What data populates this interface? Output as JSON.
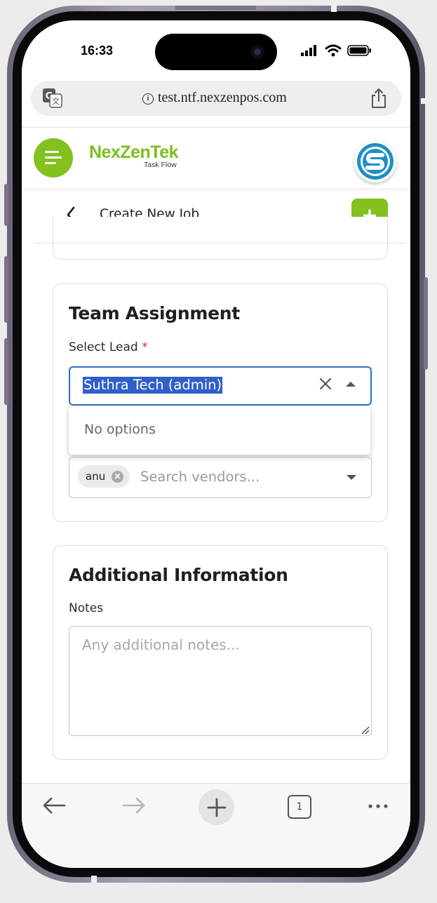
{
  "status_bar": {
    "time": "16:33"
  },
  "browser": {
    "url": "test.ntf.nexzenpos.com",
    "tab_count": "1"
  },
  "app": {
    "brand_name": "NexZenTek",
    "brand_tagline": "Task Flow",
    "page_title": "Create New Job",
    "add_label": "+"
  },
  "team_assignment": {
    "title": "Team Assignment",
    "lead_label": "Select Lead",
    "required_mark": "*",
    "lead_value": "Suthra Tech (admin)",
    "dropdown_message": "No options",
    "vendor_chip": "anu",
    "vendor_placeholder": "Search vendors..."
  },
  "additional_info": {
    "title": "Additional Information",
    "notes_label": "Notes",
    "notes_placeholder": "Any additional notes..."
  },
  "colors": {
    "brand_green": "#82c11e",
    "focus_blue": "#2f6fc0",
    "selection_blue": "#2f5fc8",
    "required_red": "#d32f2f"
  },
  "icons": [
    "translate-icon",
    "info-icon",
    "share-icon",
    "menu-icon",
    "back-chevron-icon",
    "clear-icon",
    "arrow-up-icon",
    "arrow-down-icon",
    "chip-remove-icon",
    "resize-icon",
    "back-arrow-icon",
    "forward-arrow-icon",
    "plus-icon",
    "tabs-icon",
    "more-icon"
  ]
}
